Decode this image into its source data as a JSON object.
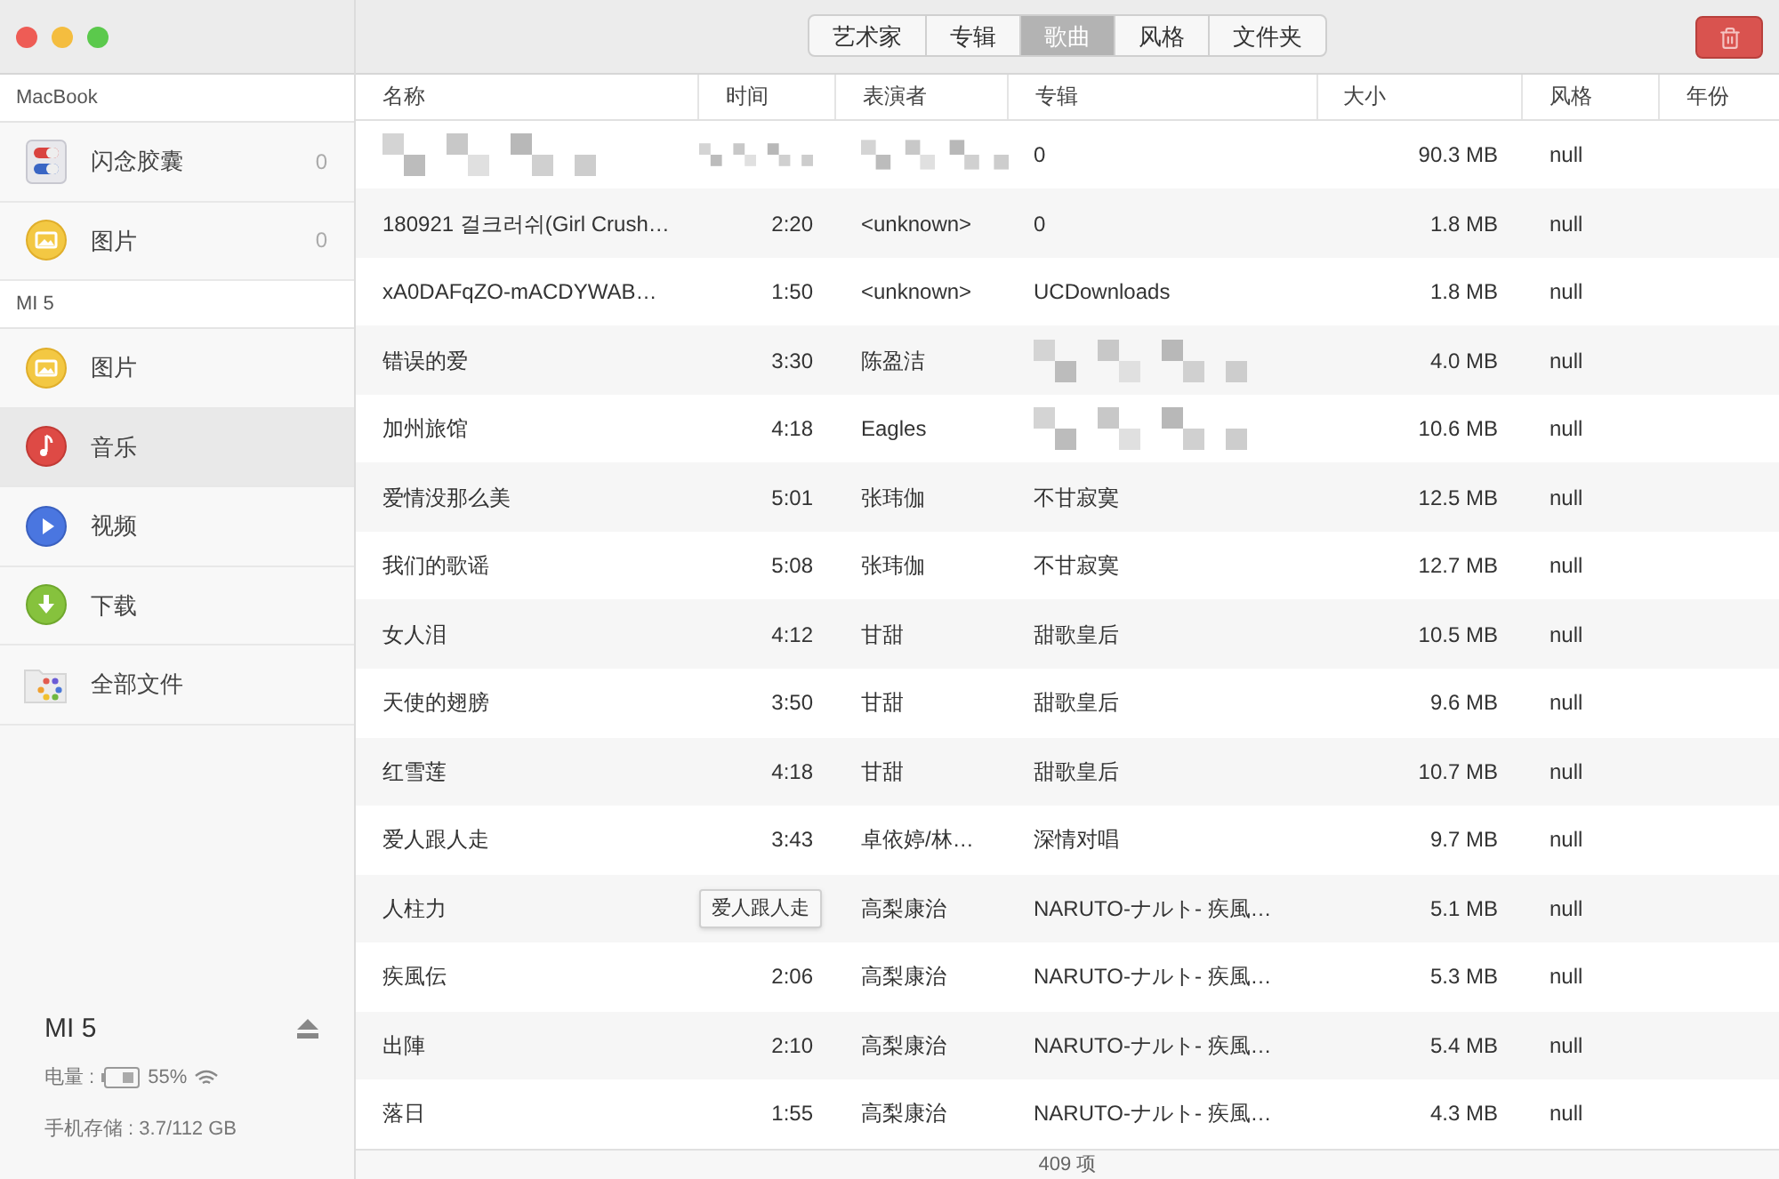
{
  "tabs": [
    {
      "label": "艺术家",
      "selected": false
    },
    {
      "label": "专辑",
      "selected": false
    },
    {
      "label": "歌曲",
      "selected": true
    },
    {
      "label": "风格",
      "selected": false
    },
    {
      "label": "文件夹",
      "selected": false
    }
  ],
  "sidebar": {
    "sections": [
      {
        "title": "MacBook",
        "items": [
          {
            "kind": "capsule",
            "label": "闪念胶囊",
            "count": "0",
            "selected": false
          },
          {
            "kind": "image",
            "label": "图片",
            "count": "0",
            "selected": false
          }
        ]
      },
      {
        "title": "MI 5",
        "items": [
          {
            "kind": "image",
            "label": "图片",
            "selected": false
          },
          {
            "kind": "music",
            "label": "音乐",
            "selected": true
          },
          {
            "kind": "video",
            "label": "视频",
            "selected": false
          },
          {
            "kind": "download",
            "label": "下载",
            "selected": false
          },
          {
            "kind": "files",
            "label": "全部文件",
            "selected": false
          }
        ]
      }
    ],
    "device": {
      "name": "MI 5",
      "battery_label": "电量 :",
      "battery": "55%",
      "storage": "手机存储 : 3.7/112 GB"
    }
  },
  "table": {
    "columns": [
      "名称",
      "时间",
      "表演者",
      "专辑",
      "大小",
      "风格",
      "年份"
    ],
    "rows": [
      {
        "album": "0",
        "size": "90.3 MB",
        "genre": "null"
      },
      {
        "name": "180921 걸크러쉬(Girl Crush…",
        "time": "2:20",
        "artist": "<unknown>",
        "album": "0",
        "size": "1.8 MB",
        "genre": "null"
      },
      {
        "name": "xA0DAFqZO-mACDYWAB…",
        "time": "1:50",
        "artist": "<unknown>",
        "album": "UCDownloads",
        "size": "1.8 MB",
        "genre": "null"
      },
      {
        "name": "错误的爱",
        "time": "3:30",
        "artist": "陈盈洁",
        "size": "4.0 MB",
        "genre": "null"
      },
      {
        "name": "加州旅馆",
        "time": "4:18",
        "artist": "Eagles",
        "size": "10.6 MB",
        "genre": "null"
      },
      {
        "name": "爱情没那么美",
        "time": "5:01",
        "artist": "张玮伽",
        "album": "不甘寂寞",
        "size": "12.5 MB",
        "genre": "null"
      },
      {
        "name": "我们的歌谣",
        "time": "5:08",
        "artist": "张玮伽",
        "album": "不甘寂寞",
        "size": "12.7 MB",
        "genre": "null"
      },
      {
        "name": "女人泪",
        "time": "4:12",
        "artist": "甘甜",
        "album": "甜歌皇后",
        "size": "10.5 MB",
        "genre": "null"
      },
      {
        "name": "天使的翅膀",
        "time": "3:50",
        "artist": "甘甜",
        "album": "甜歌皇后",
        "size": "9.6 MB",
        "genre": "null"
      },
      {
        "name": "红雪莲",
        "time": "4:18",
        "artist": "甘甜",
        "album": "甜歌皇后",
        "size": "10.7 MB",
        "genre": "null"
      },
      {
        "name": "爱人跟人走",
        "time": "3:43",
        "artist": "卓依婷/林…",
        "album": "深情对唱",
        "size": "9.7 MB",
        "genre": "null"
      },
      {
        "name": "人柱力",
        "tooltip": "爱人跟人走",
        "artist": "高梨康治",
        "album": "NARUTO-ナルト- 疾風…",
        "size": "5.1 MB",
        "genre": "null"
      },
      {
        "name": "疾風伝",
        "time": "2:06",
        "artist": "高梨康治",
        "album": "NARUTO-ナルト- 疾風…",
        "size": "5.3 MB",
        "genre": "null"
      },
      {
        "name": "出陣",
        "time": "2:10",
        "artist": "高梨康治",
        "album": "NARUTO-ナルト- 疾風…",
        "size": "5.4 MB",
        "genre": "null"
      },
      {
        "name": "落日",
        "time": "1:55",
        "artist": "高梨康治",
        "album": "NARUTO-ナルト- 疾風…",
        "size": "4.3 MB",
        "genre": "null"
      }
    ]
  },
  "status_bar": "409 项"
}
